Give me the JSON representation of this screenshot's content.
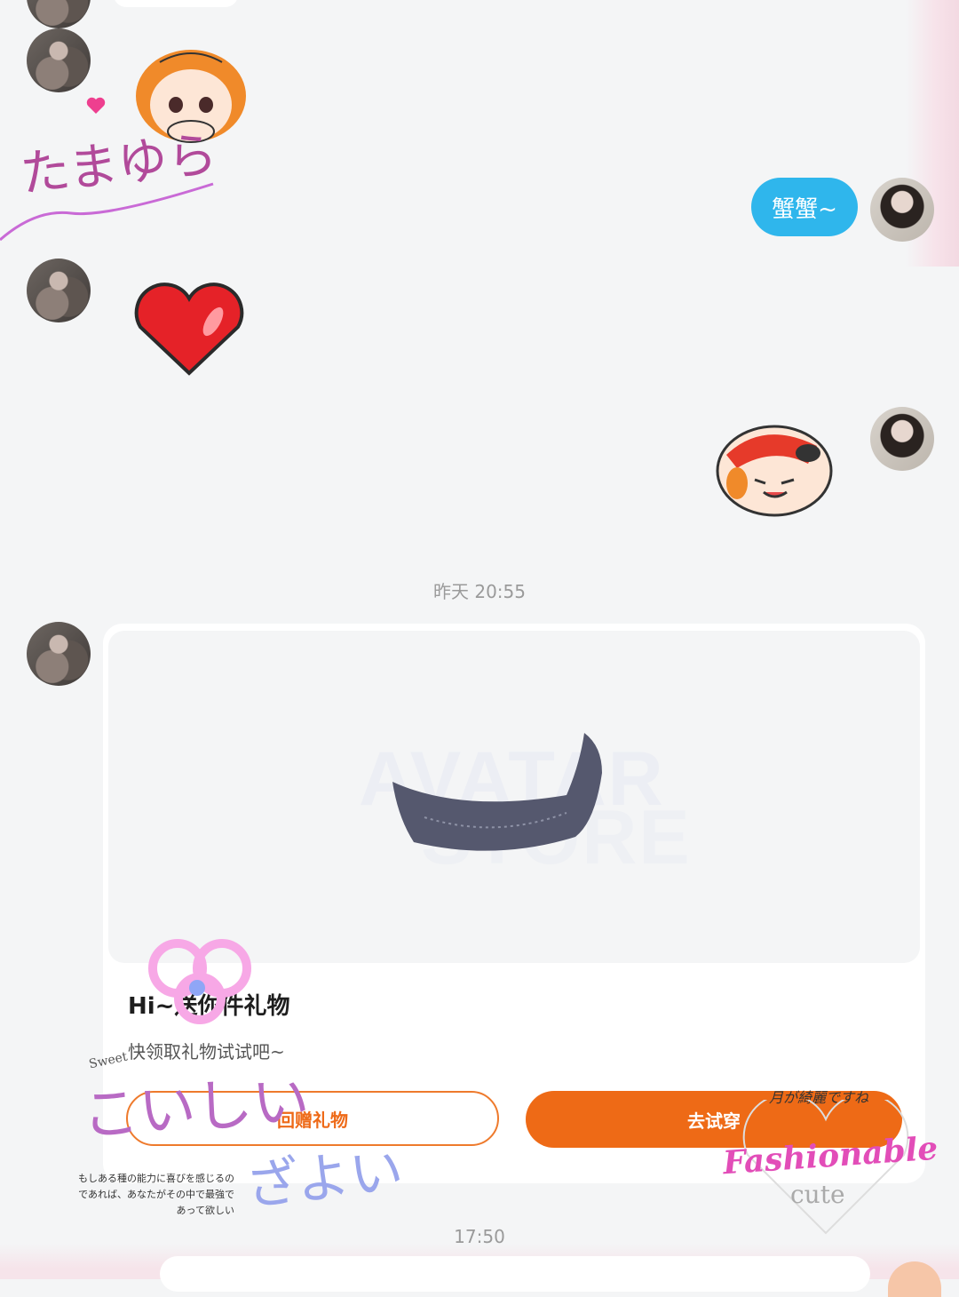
{
  "messages": {
    "sent_text": "蟹蟹~"
  },
  "timestamps": {
    "first": "昨天 20:55",
    "second": "17:50"
  },
  "gift_card": {
    "image_watermark_top": "AVATAR",
    "image_watermark_bottom": "STORE",
    "title": "Hi~送你件礼物",
    "subtitle": "快领取礼物试试吧~",
    "return_gift_label": "回赠礼物",
    "try_on_label": "去试穿"
  },
  "decorations": {
    "handwriting_top": "たまゆら",
    "handwriting_bottom_1": "こいしい",
    "handwriting_bottom_2": "ざよい",
    "tiny_sweet": "Sweet",
    "jp_small_text": "もしある種の能力に喜びを感じるのであれば、あなたがその中で最強であって欲しい",
    "jp_tagline": "月が綺麗ですね",
    "fashionable": "Fashionable",
    "cute": "cute"
  },
  "colors": {
    "accent_orange": "#ee6a16",
    "bubble_blue": "#2fb6ec"
  }
}
